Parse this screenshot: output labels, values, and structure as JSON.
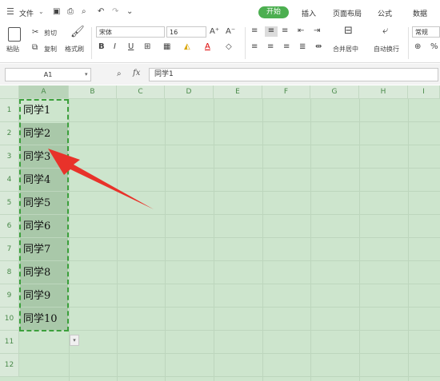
{
  "menu": {
    "hamburger_icon": "menu-icon",
    "file_label": "文件",
    "tabs": [
      "开始",
      "插入",
      "页面布局",
      "公式",
      "数据"
    ]
  },
  "ribbon": {
    "paste": "粘贴",
    "cut": "剪切",
    "copy": "复制",
    "format_painter": "格式刷",
    "font_name": "宋体",
    "font_size": "16",
    "merge_center": "合并居中",
    "wrap_text": "自动换行",
    "number_format": "常规"
  },
  "formula_bar": {
    "name_box": "A1",
    "fx": "fx",
    "value": "同学1"
  },
  "sheet": {
    "columns": [
      "A",
      "B",
      "C",
      "D",
      "E",
      "F",
      "G",
      "H",
      "I"
    ],
    "rows": [
      "1",
      "2",
      "3",
      "4",
      "5",
      "6",
      "7",
      "8",
      "9",
      "10",
      "11",
      "12"
    ],
    "col_a_values": [
      "同学1",
      "同学2",
      "同学3",
      "同学4",
      "同学5",
      "同学6",
      "同学7",
      "同学8",
      "同学9",
      "同学10"
    ]
  },
  "colors": {
    "accent": "#4caf50",
    "selection_fill": "#a9c8a9",
    "grid_bg": "#cde5cd",
    "arrow": "#e8322a"
  }
}
